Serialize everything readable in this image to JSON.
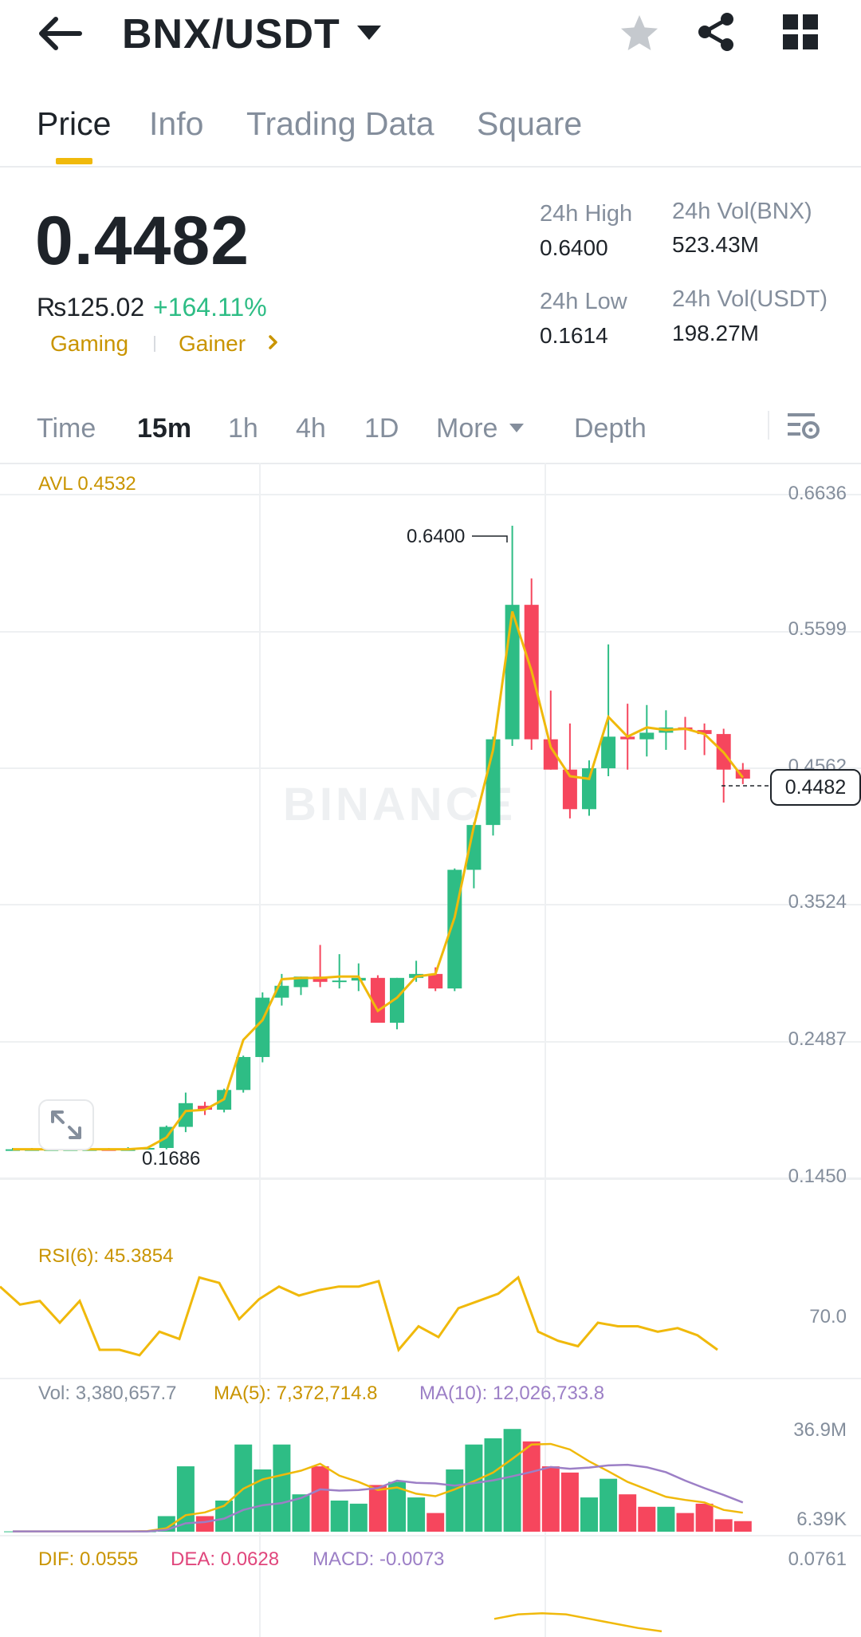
{
  "header": {
    "pair": "BNX/USDT",
    "icons": [
      "back-arrow-icon",
      "dropdown-caret-icon",
      "star-icon",
      "share-icon",
      "grid-icon"
    ]
  },
  "tabs": [
    {
      "label": "Price",
      "active": true
    },
    {
      "label": "Info",
      "active": false
    },
    {
      "label": "Trading Data",
      "active": false
    },
    {
      "label": "Square",
      "active": false
    }
  ],
  "ticker": {
    "price": "0.4482",
    "fiat": "₨125.02",
    "change": "+164.11%",
    "tags": [
      "Gaming",
      "Gainer"
    ],
    "stats": {
      "high_label": "24h High",
      "high": "0.6400",
      "low_label": "24h Low",
      "low": "0.1614",
      "vol_base_label": "24h Vol(BNX)",
      "vol_base": "523.43M",
      "vol_quote_label": "24h Vol(USDT)",
      "vol_quote": "198.27M"
    }
  },
  "timeframes": [
    {
      "label": "Time",
      "active": false
    },
    {
      "label": "15m",
      "active": true
    },
    {
      "label": "1h",
      "active": false
    },
    {
      "label": "4h",
      "active": false
    },
    {
      "label": "1D",
      "active": false
    },
    {
      "label": "More",
      "active": false
    },
    {
      "label": "Depth",
      "active": false
    }
  ],
  "chart": {
    "avl_label": "AVL 0.4532",
    "y_ticks": [
      "0.6636",
      "0.5599",
      "0.4562",
      "0.3524",
      "0.2487",
      "0.1450"
    ],
    "high_marker": "0.6400",
    "low_marker": "0.1686",
    "last_price": "0.4482",
    "watermark": "BINANCE",
    "rsi_label": "RSI(6): 45.3854",
    "rsi_tick": "70.0",
    "vol_label": "Vol: 3,380,657.7",
    "ma5_label": "MA(5): 7,372,714.8",
    "ma10_label": "MA(10): 12,026,733.8",
    "vol_ticks": [
      "36.9M",
      "6.39K"
    ],
    "dif_label": "DIF: 0.0555",
    "dea_label": "DEA: 0.0628",
    "macd_label": "MACD: -0.0073",
    "macd_tick": "0.0761",
    "colors": {
      "up": "#2ebd85",
      "down": "#f6465d",
      "ma": "#f0b90b",
      "ma10": "#9c7fc6",
      "dea": "#e0467c"
    }
  },
  "chart_data": {
    "type": "candlestick",
    "ylim": [
      0.145,
      0.6636
    ],
    "candles": [
      {
        "o": 0.167,
        "h": 0.168,
        "l": 0.166,
        "c": 0.167
      },
      {
        "o": 0.167,
        "h": 0.168,
        "l": 0.166,
        "c": 0.167
      },
      {
        "o": 0.167,
        "h": 0.168,
        "l": 0.166,
        "c": 0.167
      },
      {
        "o": 0.167,
        "h": 0.168,
        "l": 0.166,
        "c": 0.167
      },
      {
        "o": 0.167,
        "h": 0.168,
        "l": 0.166,
        "c": 0.167
      },
      {
        "o": 0.167,
        "h": 0.168,
        "l": 0.166,
        "c": 0.166
      },
      {
        "o": 0.166,
        "h": 0.168,
        "l": 0.1686,
        "c": 0.167
      },
      {
        "o": 0.167,
        "h": 0.168,
        "l": 0.167,
        "c": 0.168
      },
      {
        "o": 0.168,
        "h": 0.185,
        "l": 0.167,
        "c": 0.184
      },
      {
        "o": 0.184,
        "h": 0.21,
        "l": 0.18,
        "c": 0.202
      },
      {
        "o": 0.2,
        "h": 0.203,
        "l": 0.193,
        "c": 0.197
      },
      {
        "o": 0.197,
        "h": 0.213,
        "l": 0.195,
        "c": 0.212
      },
      {
        "o": 0.212,
        "h": 0.238,
        "l": 0.21,
        "c": 0.237
      },
      {
        "o": 0.237,
        "h": 0.286,
        "l": 0.233,
        "c": 0.282
      },
      {
        "o": 0.282,
        "h": 0.3,
        "l": 0.276,
        "c": 0.291
      },
      {
        "o": 0.29,
        "h": 0.298,
        "l": 0.284,
        "c": 0.298
      },
      {
        "o": 0.298,
        "h": 0.322,
        "l": 0.29,
        "c": 0.294
      },
      {
        "o": 0.294,
        "h": 0.315,
        "l": 0.289,
        "c": 0.295
      },
      {
        "o": 0.295,
        "h": 0.308,
        "l": 0.287,
        "c": 0.297
      },
      {
        "o": 0.297,
        "h": 0.299,
        "l": 0.278,
        "c": 0.263
      },
      {
        "o": 0.263,
        "h": 0.297,
        "l": 0.258,
        "c": 0.297
      },
      {
        "o": 0.297,
        "h": 0.31,
        "l": 0.294,
        "c": 0.3
      },
      {
        "o": 0.3,
        "h": 0.305,
        "l": 0.287,
        "c": 0.289
      },
      {
        "o": 0.289,
        "h": 0.38,
        "l": 0.287,
        "c": 0.379
      },
      {
        "o": 0.379,
        "h": 0.415,
        "l": 0.365,
        "c": 0.413
      },
      {
        "o": 0.413,
        "h": 0.48,
        "l": 0.405,
        "c": 0.478
      },
      {
        "o": 0.478,
        "h": 0.64,
        "l": 0.473,
        "c": 0.58
      },
      {
        "o": 0.58,
        "h": 0.6,
        "l": 0.47,
        "c": 0.478
      },
      {
        "o": 0.478,
        "h": 0.515,
        "l": 0.455,
        "c": 0.455
      },
      {
        "o": 0.455,
        "h": 0.49,
        "l": 0.418,
        "c": 0.425
      },
      {
        "o": 0.425,
        "h": 0.462,
        "l": 0.42,
        "c": 0.456
      },
      {
        "o": 0.456,
        "h": 0.55,
        "l": 0.45,
        "c": 0.48
      },
      {
        "o": 0.48,
        "h": 0.505,
        "l": 0.455,
        "c": 0.478
      },
      {
        "o": 0.478,
        "h": 0.504,
        "l": 0.465,
        "c": 0.483
      },
      {
        "o": 0.483,
        "h": 0.5,
        "l": 0.47,
        "c": 0.487
      },
      {
        "o": 0.487,
        "h": 0.495,
        "l": 0.47,
        "c": 0.485
      },
      {
        "o": 0.485,
        "h": 0.49,
        "l": 0.466,
        "c": 0.482
      },
      {
        "o": 0.482,
        "h": 0.486,
        "l": 0.43,
        "c": 0.455
      },
      {
        "o": 0.455,
        "h": 0.46,
        "l": 0.444,
        "c": 0.4482
      }
    ],
    "ma_line": [
      0.167,
      0.167,
      0.167,
      0.167,
      0.167,
      0.167,
      0.167,
      0.168,
      0.176,
      0.196,
      0.197,
      0.205,
      0.25,
      0.265,
      0.296,
      0.297,
      0.297,
      0.298,
      0.298,
      0.272,
      0.282,
      0.298,
      0.3,
      0.343,
      0.412,
      0.47,
      0.575,
      0.53,
      0.472,
      0.45,
      0.448,
      0.495,
      0.48,
      0.487,
      0.485,
      0.486,
      0.482,
      0.468,
      0.449
    ],
    "rsi": [
      90,
      80,
      82,
      70,
      82,
      55,
      55,
      52,
      65,
      61,
      95,
      92,
      72,
      83,
      90,
      85,
      88,
      90,
      90,
      93,
      55,
      68,
      62,
      78,
      82,
      86,
      95,
      65,
      60,
      57,
      70,
      68,
      68,
      65,
      67,
      63,
      55
    ],
    "rsi_ylim": [
      40,
      100
    ],
    "volume_m": [
      0.1,
      0.1,
      0.1,
      0.1,
      0.1,
      0.1,
      0.1,
      0.1,
      5,
      21,
      5,
      10,
      28,
      20,
      28,
      12,
      21,
      10,
      9,
      15,
      16,
      11,
      6,
      20,
      28,
      30,
      33,
      29,
      21,
      19,
      11,
      17,
      12,
      8,
      8,
      6,
      9,
      4,
      3.4
    ],
    "volume_up": [
      1,
      1,
      1,
      1,
      1,
      1,
      1,
      1,
      1,
      1,
      0,
      1,
      1,
      1,
      1,
      1,
      0,
      1,
      1,
      0,
      1,
      1,
      0,
      1,
      1,
      1,
      1,
      0,
      0,
      0,
      1,
      1,
      0,
      0,
      1,
      0,
      0,
      0,
      0
    ],
    "vol_ma5_m": [
      0.1,
      0.1,
      0.1,
      0.1,
      0.1,
      0.1,
      0.1,
      0.2,
      1.1,
      5.3,
      6.2,
      8.3,
      13.8,
      16.8,
      18.2,
      19.6,
      21.8,
      18.0,
      16.0,
      13.4,
      14.2,
      12.2,
      11.4,
      13.6,
      16.2,
      19.0,
      23.4,
      28.0,
      28.2,
      26.4,
      22.6,
      19.4,
      16.0,
      13.6,
      11.2,
      10.2,
      9.4,
      7.0,
      6.1
    ],
    "vol_ma10_m": [
      0.1,
      0.1,
      0.1,
      0.1,
      0.1,
      0.1,
      0.1,
      0.1,
      0.6,
      2.7,
      3.1,
      4.2,
      7.0,
      8.5,
      9.2,
      10.8,
      13.6,
      13.2,
      13.4,
      14.0,
      16.4,
      15.7,
      15.5,
      14.8,
      15.6,
      16.5,
      17.8,
      19.2,
      20.8,
      20.2,
      20.6,
      21.3,
      21.5,
      20.7,
      19.1,
      16.4,
      14.0,
      11.8,
      9.4
    ],
    "macd_dif": [
      0.066,
      0.07,
      0.071,
      0.07,
      0.066,
      0.062,
      0.058,
      0.055
    ]
  }
}
